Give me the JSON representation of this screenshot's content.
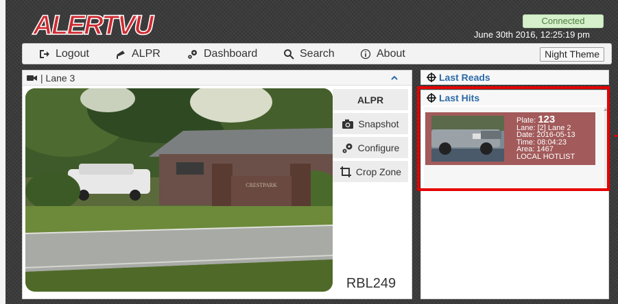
{
  "brand": {
    "logo_text": "ALERTVU",
    "logo_color": "#cf2a31"
  },
  "status": {
    "connection": "Connected",
    "datetime": "June 30th 2016, 12:25:19 pm"
  },
  "nav": {
    "items": [
      {
        "label": "Logout",
        "icon": "logout-icon"
      },
      {
        "label": "ALPR",
        "icon": "alpr-camera-icon"
      },
      {
        "label": "Dashboard",
        "icon": "cogs-icon"
      },
      {
        "label": "Search",
        "icon": "search-icon"
      },
      {
        "label": "About",
        "icon": "info-icon"
      }
    ],
    "night_theme": "Night Theme"
  },
  "camera": {
    "title": "| Lane 3",
    "sign_text": "CRESTPARK",
    "buttons": {
      "alpr": "ALPR",
      "snapshot": "Snapshot",
      "configure": "Configure",
      "crop_zone": "Crop Zone"
    },
    "plate_read": "RBL249"
  },
  "panels": {
    "last_reads": "Last Reads",
    "last_hits": "Last Hits"
  },
  "hit": {
    "plate_label": "Plate:",
    "plate_value": "123",
    "lane": "Lane: [2] Lane 2",
    "date": "Date: 2016-05-13",
    "time": "Time: 08:04:23",
    "area": "Area: 1467",
    "list": "LOCAL HOTLIST"
  },
  "colors": {
    "link_blue": "#2c6aa8",
    "hit_bg": "#a25a5a",
    "highlight": "#e50000",
    "connected_bg": "#d6f0cc"
  }
}
